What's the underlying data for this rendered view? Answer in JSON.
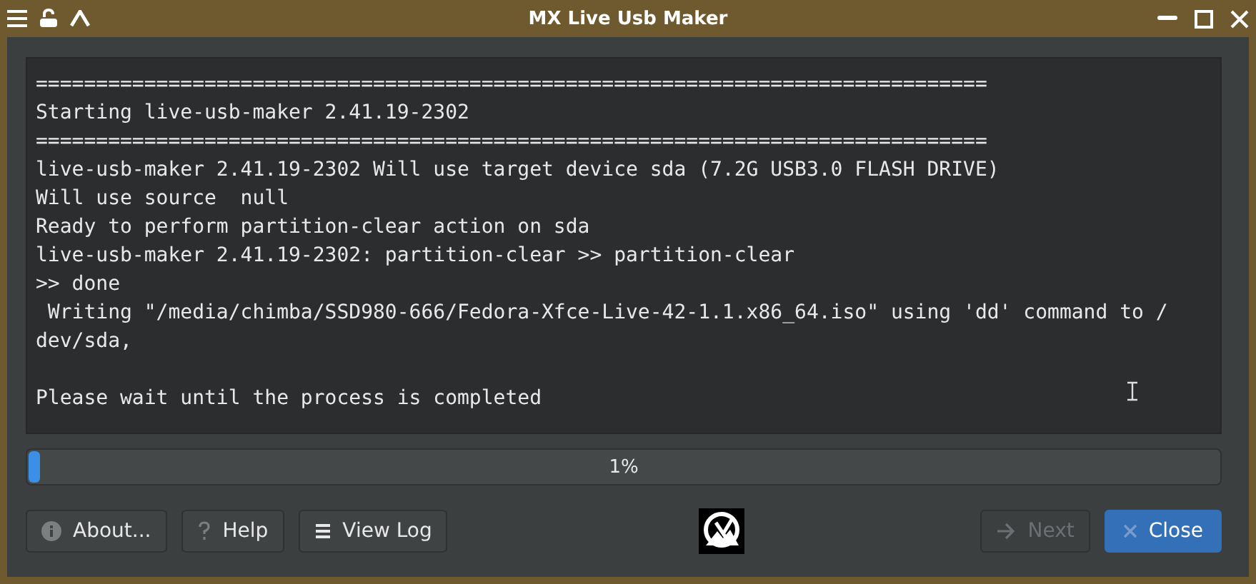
{
  "window": {
    "title": "MX Live Usb Maker"
  },
  "log": {
    "blocks": [
      {
        "lines": [
          "===============================================================================",
          "Starting live-usb-maker 2.41.19-2302",
          "===============================================================================",
          "live-usb-maker 2.41.19-2302 Will use target device sda (7.2G USB3.0 FLASH DRIVE)",
          "Will use source  null",
          "Ready to perform partition-clear action on sda",
          "live-usb-maker 2.41.19-2302: partition-clear >> partition-clear",
          ">> done",
          " Writing \"/media/chimba/SSD980-666/Fedora-Xfce-Live-42-1.1.x86_64.iso\" using 'dd' command to /",
          "dev/sda,"
        ]
      },
      {
        "lines": [
          "Please wait until the process is completed"
        ]
      }
    ]
  },
  "progress": {
    "level": 0.01,
    "reading": "1%"
  },
  "buttons": [
    {
      "kind": "info",
      "label": "About...",
      "disabled": false,
      "primary": false
    },
    {
      "kind": "help",
      "label": "Help",
      "disabled": false,
      "primary": false
    },
    {
      "kind": "log",
      "label": "View Log",
      "disabled": false,
      "primary": false
    },
    {
      "kind": "logo"
    },
    {
      "kind": "next",
      "label": "Next",
      "disabled": true,
      "primary": false
    },
    {
      "kind": "close",
      "label": "Close",
      "disabled": false,
      "primary": true
    }
  ]
}
